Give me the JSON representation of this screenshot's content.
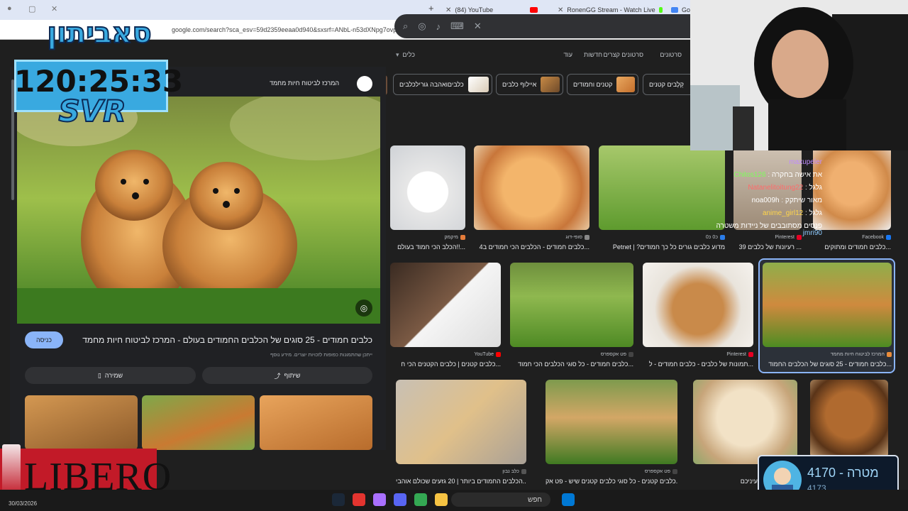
{
  "browser": {
    "tabs": [
      {
        "label": "(84) YouTube",
        "color": "#ff0000"
      },
      {
        "label": "RonenGG Stream - Watch Live",
        "color": "#53fc18"
      },
      {
        "label": "Go",
        "color": "#4285f4"
      }
    ],
    "url": "google.com/search?sca_esv=59d2359eeaa0d940&sxsrf=ANbL-n53dXNpg7ovpq1Sk8d5hKojwHo-MQ:1774829858421&udm=2&fbs=ADc_l-bESSfx2HQfAE4Kap5i6KpaX2kho-wuc"
  },
  "google": {
    "filters": [
      "סרטונים",
      "סרטונים קצרים",
      "חדשות",
      "עוד",
      "כלים"
    ],
    "chips": [
      "קְלָבים קטנים",
      "קטנים וחמודים",
      "איילוף כלבים",
      "כלביםואהבה גורילכלבים"
    ]
  },
  "panel": {
    "source": "המרכז לביטוח חיות מחמד",
    "title": "כלבים חמודים - 25 סוגים של הכלבים החמודים בעולם - המרכז לביטוח חיות מחמד",
    "visit": "כניסה",
    "note": "ייתכן שהתמונות כפופות לזכויות יוצרים. מידע נוסף",
    "share": "שיתוף",
    "save": "שמירה"
  },
  "results": [
    {
      "source": "מיקמק",
      "caption": "הכלב הכי חמוד בעולם!!..."
    },
    {
      "source": "סופי-דוג",
      "caption": "כלבים חמודים - הכלבים הכי חמודים ב4..."
    },
    {
      "source": "כ0 כ0",
      "caption": "Petnet | ?מדוע כלבים גורים כל כך חמודים"
    },
    {
      "source": "Pinterest",
      "caption": "39 רעיונות של כלבים ..."
    },
    {
      "source": "Facebook",
      "caption": "כלבים חמודים ומתוקים..."
    },
    {
      "source": "YouTube",
      "caption": "כלבים קטנים | כלבים הקטנים הכי ח..."
    },
    {
      "source": "פט אקספרס",
      "caption": "כלבים חמודים - כל סוגי הכלבים הכי חמוד..."
    },
    {
      "source": "Pinterest",
      "caption": "תמונות של כלבים - כלבים חמודים - ל..."
    },
    {
      "source": "המרכז לביטוח חיות מחמד",
      "caption": "כלבים חמודים - 25 סוגים של הכלבים החמוד..."
    },
    {
      "source": "כלב נבון",
      "caption": "הכלבים החמודים ביותר | 20 גזעים שכולם אוהבי..."
    },
    {
      "source": "פט אקספרס",
      "caption": "כלבים קטנים - כל סוגי כלבים קטנים שיש - פט אק..."
    },
    {
      "source": "",
      "caption": "אני חמוד בעיניכם ?..."
    }
  ],
  "overlay": {
    "logo": "סאביתון",
    "timer": "120:25:33",
    "brand": "SVR",
    "libero": "LIBERO",
    "chat": [
      {
        "user": "maxupeler",
        "msg": ""
      },
      {
        "user": "Chitos126",
        "msg": "את אישה בחקרה"
      },
      {
        "user": "Natanelitoitung22",
        "msg": "גלגל"
      },
      {
        "user": "noa009h",
        "msg": "מאור שיתקק"
      },
      {
        "user": "anime_girl12",
        "msg": "גלגל"
      },
      {
        "user": "",
        "msg": "פנסים מסתובבים של ניידות משטרה"
      },
      {
        "user": "jmri90",
        "msg": ""
      }
    ],
    "goal_label": "4170 - מטרה",
    "goal_sub": "4173"
  },
  "taskbar": {
    "search": "חפש",
    "date": "30/03/2026"
  },
  "colors": {
    "accent": "#8ab4f8",
    "timer_bg": "#39a9e0",
    "libero_bg": "#c21a28"
  }
}
